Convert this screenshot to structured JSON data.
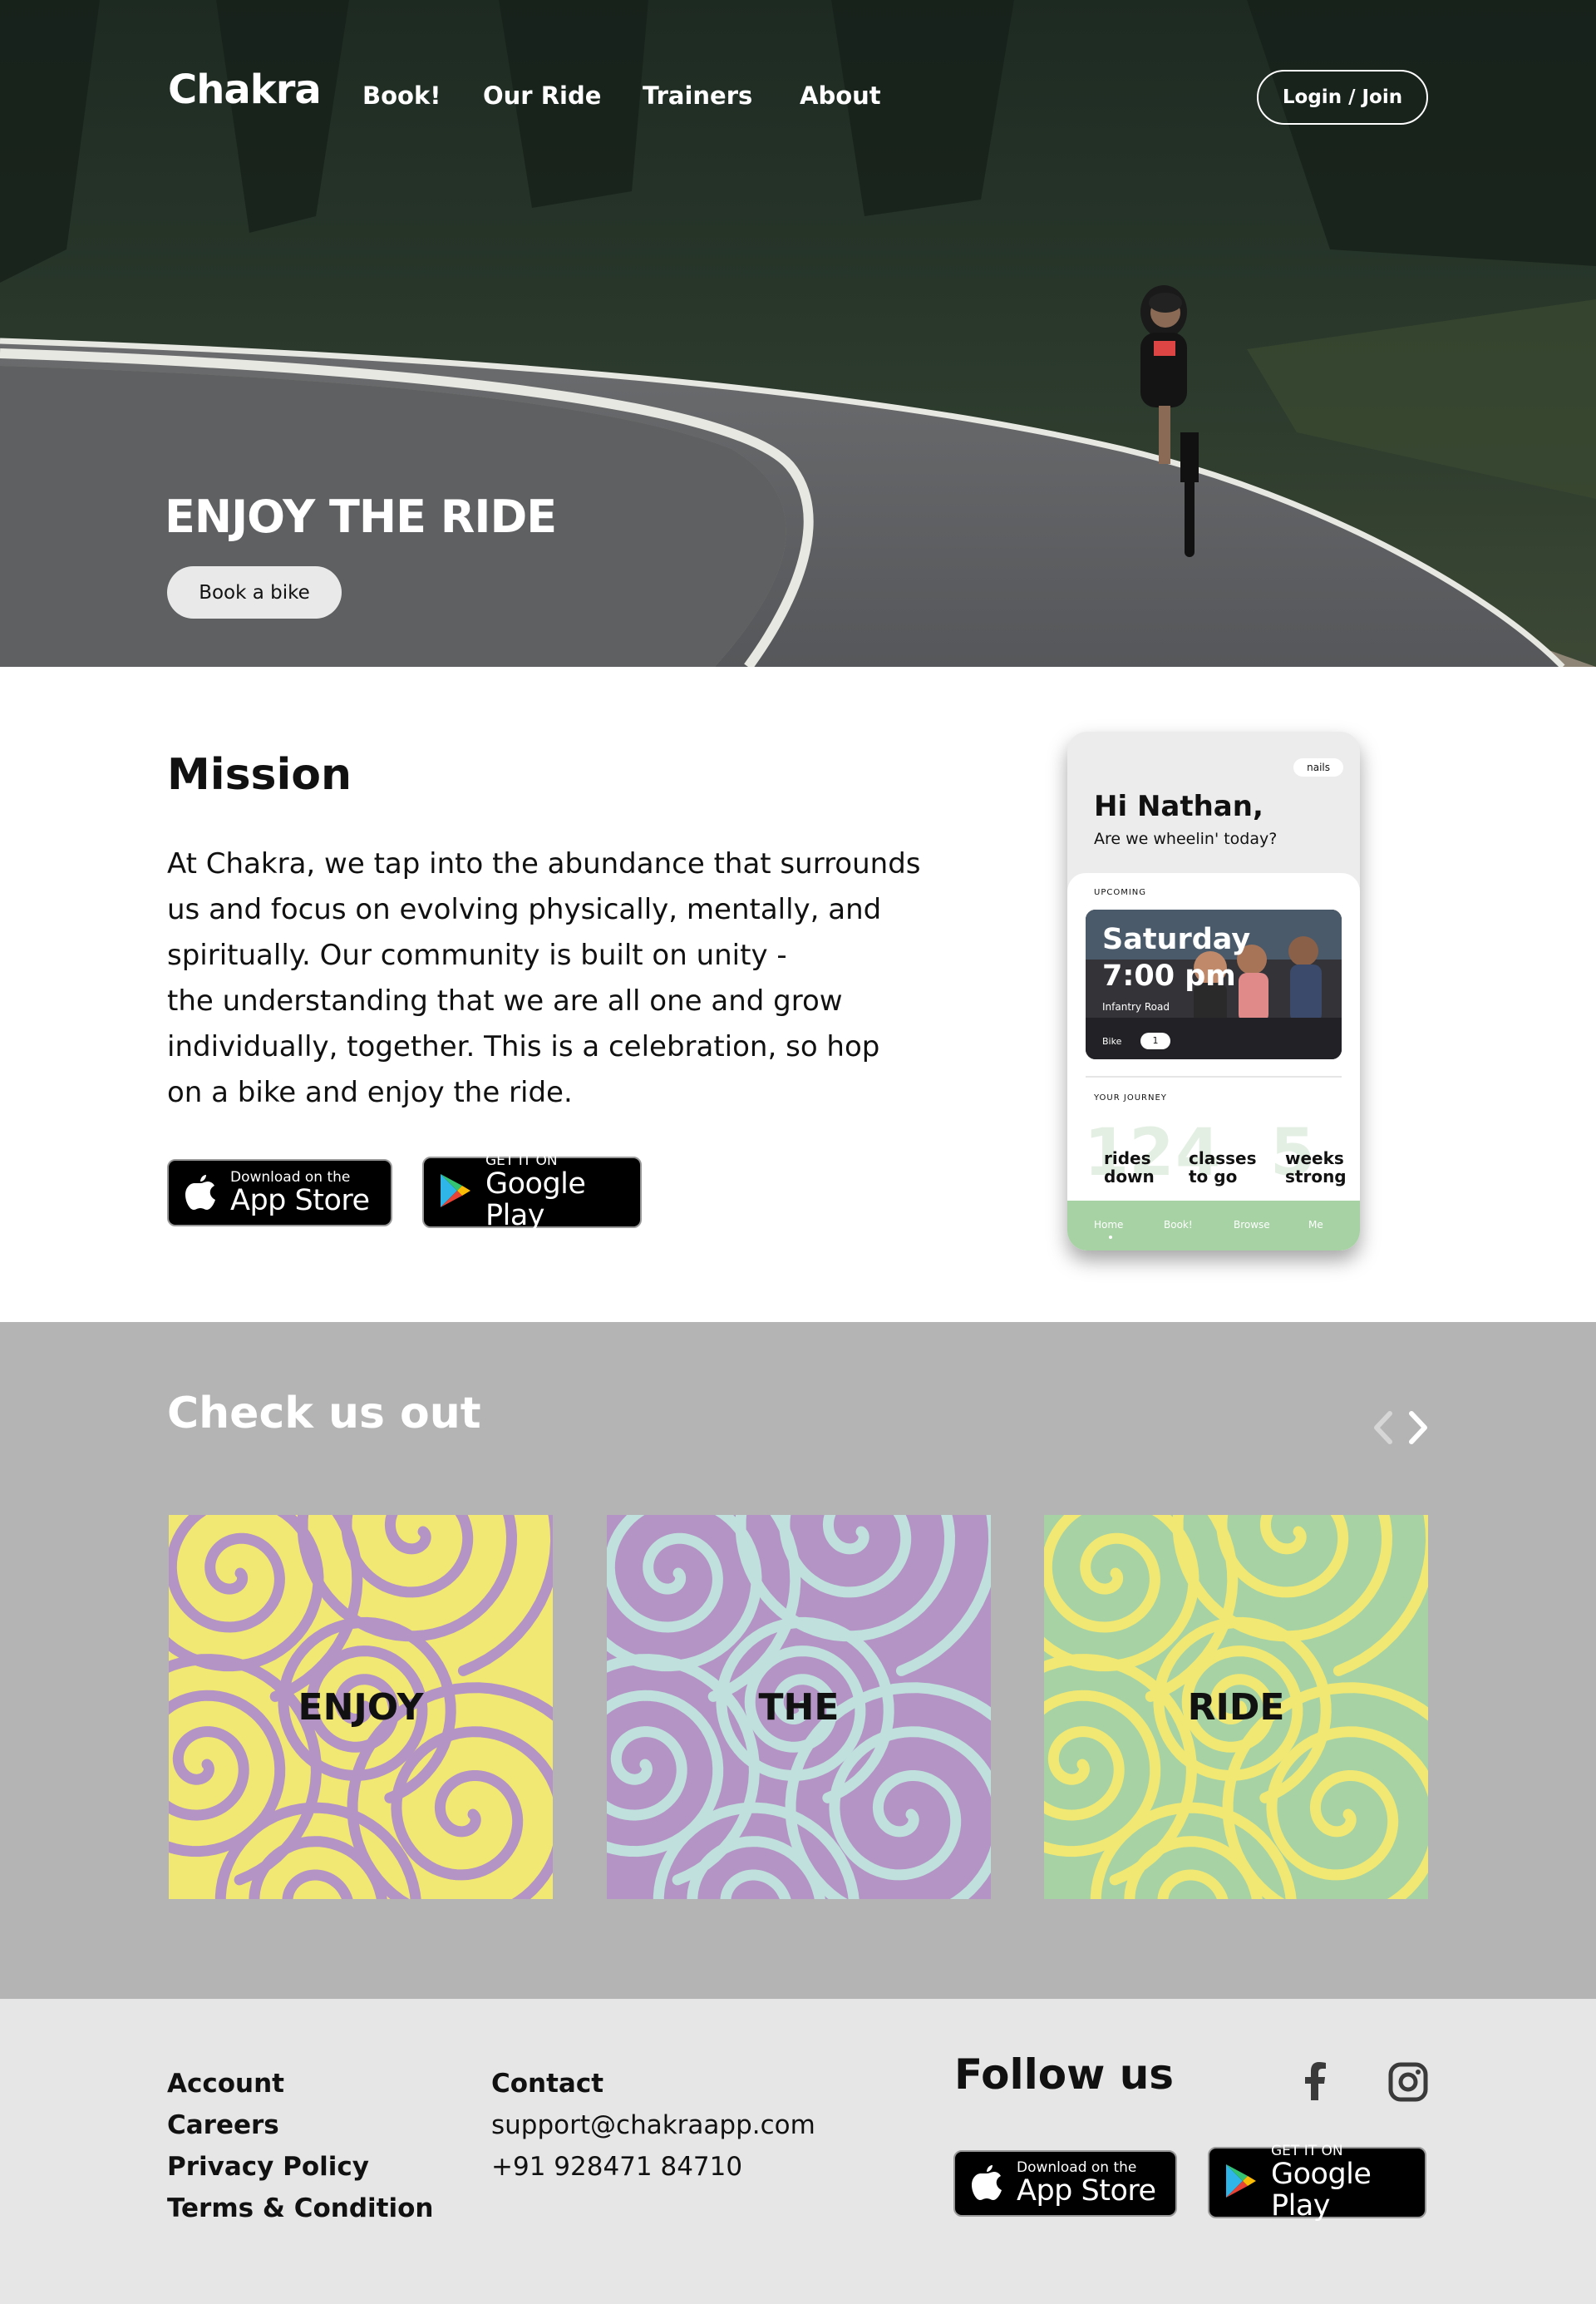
{
  "header": {
    "brand": "Chakra",
    "nav": [
      "Book!",
      "Our Ride",
      "Trainers",
      "About"
    ],
    "login_label": "Login / Join"
  },
  "hero": {
    "title": "ENJOY THE RIDE",
    "cta_label": "Book a bike"
  },
  "mission": {
    "title": "Mission",
    "lines": [
      "At Chakra, we tap into the abundance that surrounds",
      "us and focus on evolving physically, mentally, and",
      "spiritually. Our community is built on unity -",
      "the understanding that we are all one and grow",
      "individually, together. This is a celebration, so hop",
      "on a bike and enjoy the ride."
    ]
  },
  "badges": {
    "apple_small": "Download on the",
    "apple_big": "App Store",
    "google_small": "GET IT ON",
    "google_big": "Google Play"
  },
  "phone": {
    "pill": "nails",
    "greeting": "Hi Nathan,",
    "subtitle": "Are we wheelin' today?",
    "upcoming_label": "UPCOMING",
    "day": "Saturday",
    "time": "7:00 pm",
    "location": "Infantry Road",
    "bike_label": "Bike",
    "bike_number": "1",
    "journey_label": "YOUR JOURNEY",
    "stats": [
      {
        "num": "12",
        "label1": "rides",
        "label2": "down"
      },
      {
        "num": "4",
        "label1": "classes",
        "label2": "to go"
      },
      {
        "num": "5",
        "label1": "weeks",
        "label2": "strong"
      }
    ],
    "tabs": [
      "Home",
      "Book!",
      "Browse",
      "Me"
    ]
  },
  "check": {
    "title": "Check us out",
    "tiles": [
      "ENJOY",
      "THE",
      "RIDE"
    ]
  },
  "footer": {
    "links": [
      "Account",
      "Careers",
      "Privacy Policy",
      "Terms & Condition"
    ],
    "contact_title": "Contact",
    "email": "support@chakraapp.com",
    "phone": "+91 928471 84710",
    "follow_title": "Follow us"
  },
  "icons": {
    "facebook": "facebook-icon",
    "instagram": "instagram-icon",
    "apple": "apple-icon",
    "google_play": "google-play-icon",
    "prev": "chevron-left-icon",
    "next": "chevron-right-icon"
  },
  "colors": {
    "check_bg": "#b4b4b4",
    "footer_bg": "#e6e6e6",
    "tab_bar": "#a6d2a4",
    "yellow": "#f1e873",
    "purple": "#b394c4",
    "mint": "#bfe0dc",
    "green": "#a6d2a4"
  }
}
